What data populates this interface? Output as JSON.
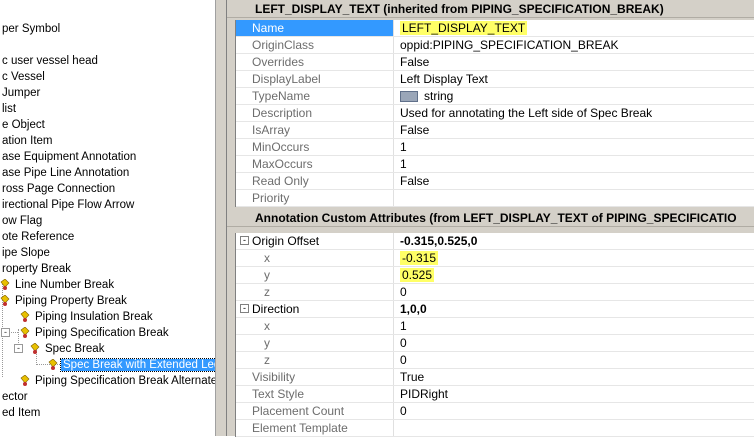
{
  "tree": {
    "items": [
      {
        "label": "per Symbol"
      },
      {
        "label": "c user vessel head"
      },
      {
        "label": "c Vessel"
      },
      {
        "label": "Jumper"
      },
      {
        "label": "list"
      },
      {
        "label": "e Object"
      },
      {
        "label": "ation Item"
      },
      {
        "label": "ase Equipment Annotation"
      },
      {
        "label": "ase Pipe Line Annotation"
      },
      {
        "label": "ross Page Connection"
      },
      {
        "label": "irectional Pipe Flow Arrow"
      },
      {
        "label": "ow Flag"
      },
      {
        "label": "ote Reference"
      },
      {
        "label": "ipe Slope"
      },
      {
        "label": "roperty Break"
      },
      {
        "label": "Line Number Break"
      },
      {
        "label": "Piping Property Break"
      },
      {
        "label": "Piping Insulation Break"
      },
      {
        "label": "Piping Specification Break"
      },
      {
        "label": "Spec Break"
      },
      {
        "label": "Spec Break with Extended Leg"
      },
      {
        "label": "Piping Specification Break Alternate"
      },
      {
        "label": "ector"
      },
      {
        "label": "ed Item"
      }
    ],
    "expanders": [
      "-",
      "-"
    ]
  },
  "section1": {
    "title": "LEFT_DISPLAY_TEXT (inherited from PIPING_SPECIFICATION_BREAK)",
    "rows": [
      {
        "name": "Name",
        "value": "LEFT_DISPLAY_TEXT"
      },
      {
        "name": "OriginClass",
        "value": "oppid:PIPING_SPECIFICATION_BREAK"
      },
      {
        "name": "Overrides",
        "value": "False"
      },
      {
        "name": "DisplayLabel",
        "value": "Left Display Text"
      },
      {
        "name": "TypeName",
        "value": "string"
      },
      {
        "name": "Description",
        "value": "Used for annotating the Left side of Spec Break"
      },
      {
        "name": "IsArray",
        "value": "False"
      },
      {
        "name": "MinOccurs",
        "value": "1"
      },
      {
        "name": "MaxOccurs",
        "value": "1"
      },
      {
        "name": "Read Only",
        "value": "False"
      },
      {
        "name": "Priority",
        "value": ""
      }
    ]
  },
  "section2": {
    "title": "Annotation Custom Attributes (from LEFT_DISPLAY_TEXT of PIPING_SPECIFICATIO",
    "origin_group": {
      "name": "Origin Offset",
      "value": "-0.315,0.525,0",
      "expander": "-"
    },
    "origin_rows": [
      {
        "name": "x",
        "value": "-0.315"
      },
      {
        "name": "y",
        "value": "0.525"
      },
      {
        "name": "z",
        "value": "0"
      }
    ],
    "direction_group": {
      "name": "Direction",
      "value": "1,0,0",
      "expander": "-"
    },
    "direction_rows": [
      {
        "name": "x",
        "value": "1"
      },
      {
        "name": "y",
        "value": "0"
      },
      {
        "name": "z",
        "value": "0"
      }
    ],
    "other_rows": [
      {
        "name": "Visibility",
        "value": "True"
      },
      {
        "name": "Text Style",
        "value": "PIDRight"
      },
      {
        "name": "Placement Count",
        "value": "0"
      },
      {
        "name": "Element Template",
        "value": ""
      }
    ]
  },
  "colors": {
    "highlight": "#ffff66",
    "selection": "#3399ff",
    "panel": "#d4d0c8"
  }
}
